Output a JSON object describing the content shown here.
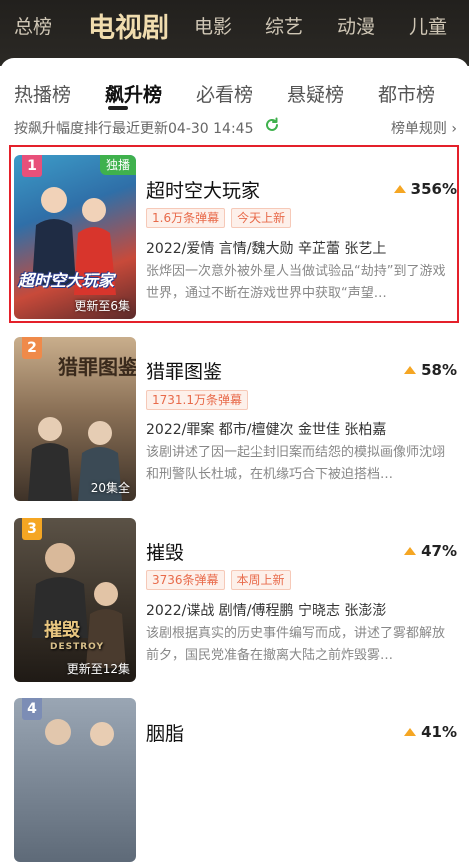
{
  "top_categories": {
    "items": [
      {
        "label": "总榜"
      },
      {
        "label": "电视剧"
      },
      {
        "label": "电影"
      },
      {
        "label": "综艺"
      },
      {
        "label": "动漫"
      },
      {
        "label": "儿童"
      }
    ],
    "active": "电视剧"
  },
  "sub_tabs": {
    "items": [
      {
        "label": "热播榜"
      },
      {
        "label": "飙升榜"
      },
      {
        "label": "必看榜"
      },
      {
        "label": "悬疑榜"
      },
      {
        "label": "都市榜"
      }
    ],
    "active": "飙升榜"
  },
  "info": {
    "sort_text": "按飙升幅度排行最近更新04-30 14:45",
    "rules_label": "榜单规则 ›"
  },
  "colors": {
    "highlight_border": "#e4202a",
    "rank_1": "#e8507a",
    "rank_2": "#ef8a4a",
    "rank_3": "#f5a623",
    "rank_4": "#7c8db5",
    "growth_arrow": "#f5a623",
    "exclusive_badge": "#3fb14d",
    "tag_text": "#e86a4a"
  },
  "list": [
    {
      "rank": "1",
      "exclusive": "独播",
      "poster_text": "超时空大玩家",
      "episodes": "更新至6集",
      "title": "超时空大玩家",
      "growth": "356%",
      "tags": [
        "1.6万条弹幕",
        "今天上新"
      ],
      "meta": "2022/爱情 言情/魏大勋 辛芷蕾 张艺上",
      "description": "张烨因一次意外被外星人当做试验品“劫持”到了游戏世界，通过不断在游戏世界中获取“声望…"
    },
    {
      "rank": "2",
      "poster_text": "猎罪图鉴",
      "episodes": "20集全",
      "title": "猎罪图鉴",
      "growth": "58%",
      "tags": [
        "1731.1万条弹幕"
      ],
      "meta": "2022/罪案 都市/檀健次 金世佳 张柏嘉",
      "description": "该剧讲述了因一起尘封旧案而结怨的模拟画像师沈翊和刑警队长杜城，在机缘巧合下被迫搭档…"
    },
    {
      "rank": "3",
      "poster_text": "摧毁",
      "poster_subtext": "DESTROY",
      "episodes": "更新至12集",
      "title": "摧毁",
      "growth": "47%",
      "tags": [
        "3736条弹幕",
        "本周上新"
      ],
      "meta": "2022/谍战 剧情/傅程鹏 宁晓志 张澎澎",
      "description": "该剧根据真实的历史事件编写而成，讲述了雾都解放前夕，国民党准备在撤离大陆之前炸毁雾…"
    },
    {
      "rank": "4",
      "title": "胭脂",
      "growth": "41%"
    }
  ]
}
